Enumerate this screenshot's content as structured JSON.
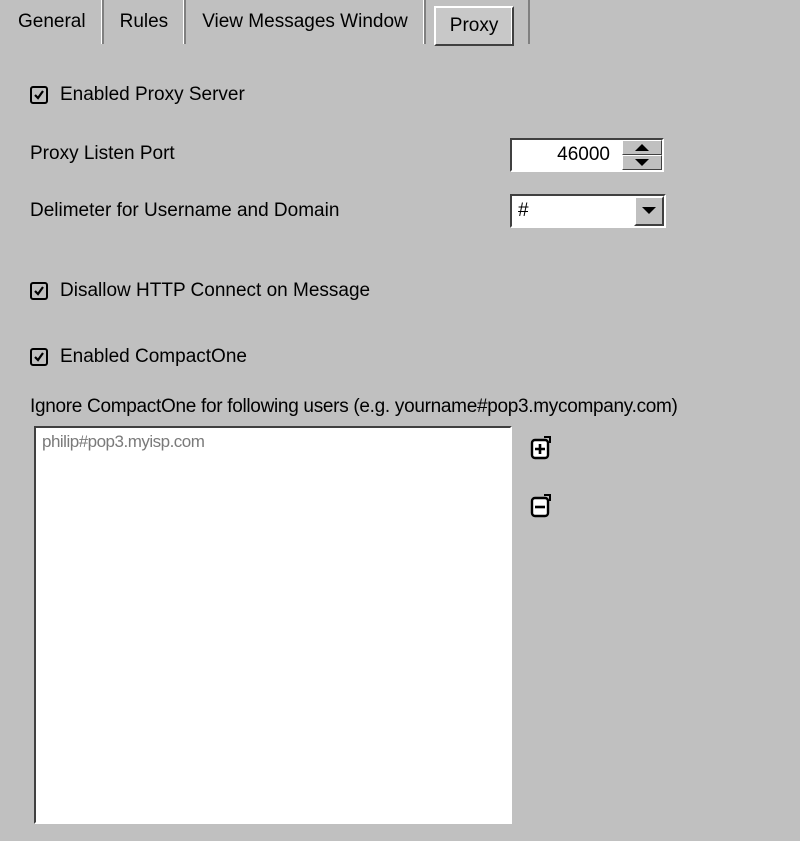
{
  "tabs": [
    {
      "label": "General",
      "active": false
    },
    {
      "label": "Rules",
      "active": false
    },
    {
      "label": "View Messages Window",
      "active": false
    },
    {
      "label": "Proxy",
      "active": true
    }
  ],
  "proxy": {
    "enabled_proxy_label": "Enabled Proxy Server",
    "enabled_proxy_checked": true,
    "listen_port_label": "Proxy Listen Port",
    "listen_port_value": "46000",
    "delimiter_label": "Delimeter for Username and Domain",
    "delimiter_value": "#",
    "disallow_http_label": "Disallow HTTP Connect on Message",
    "disallow_http_checked": true,
    "enabled_compactone_label": "Enabled CompactOne",
    "enabled_compactone_checked": true,
    "ignore_label": "Ignore CompactOne for following users (e.g. yourname#pop3.mycompany.com)",
    "ignore_users": [
      "philip#pop3.myisp.com"
    ]
  },
  "icons": {
    "add": "add-user-icon",
    "remove": "remove-user-icon"
  }
}
